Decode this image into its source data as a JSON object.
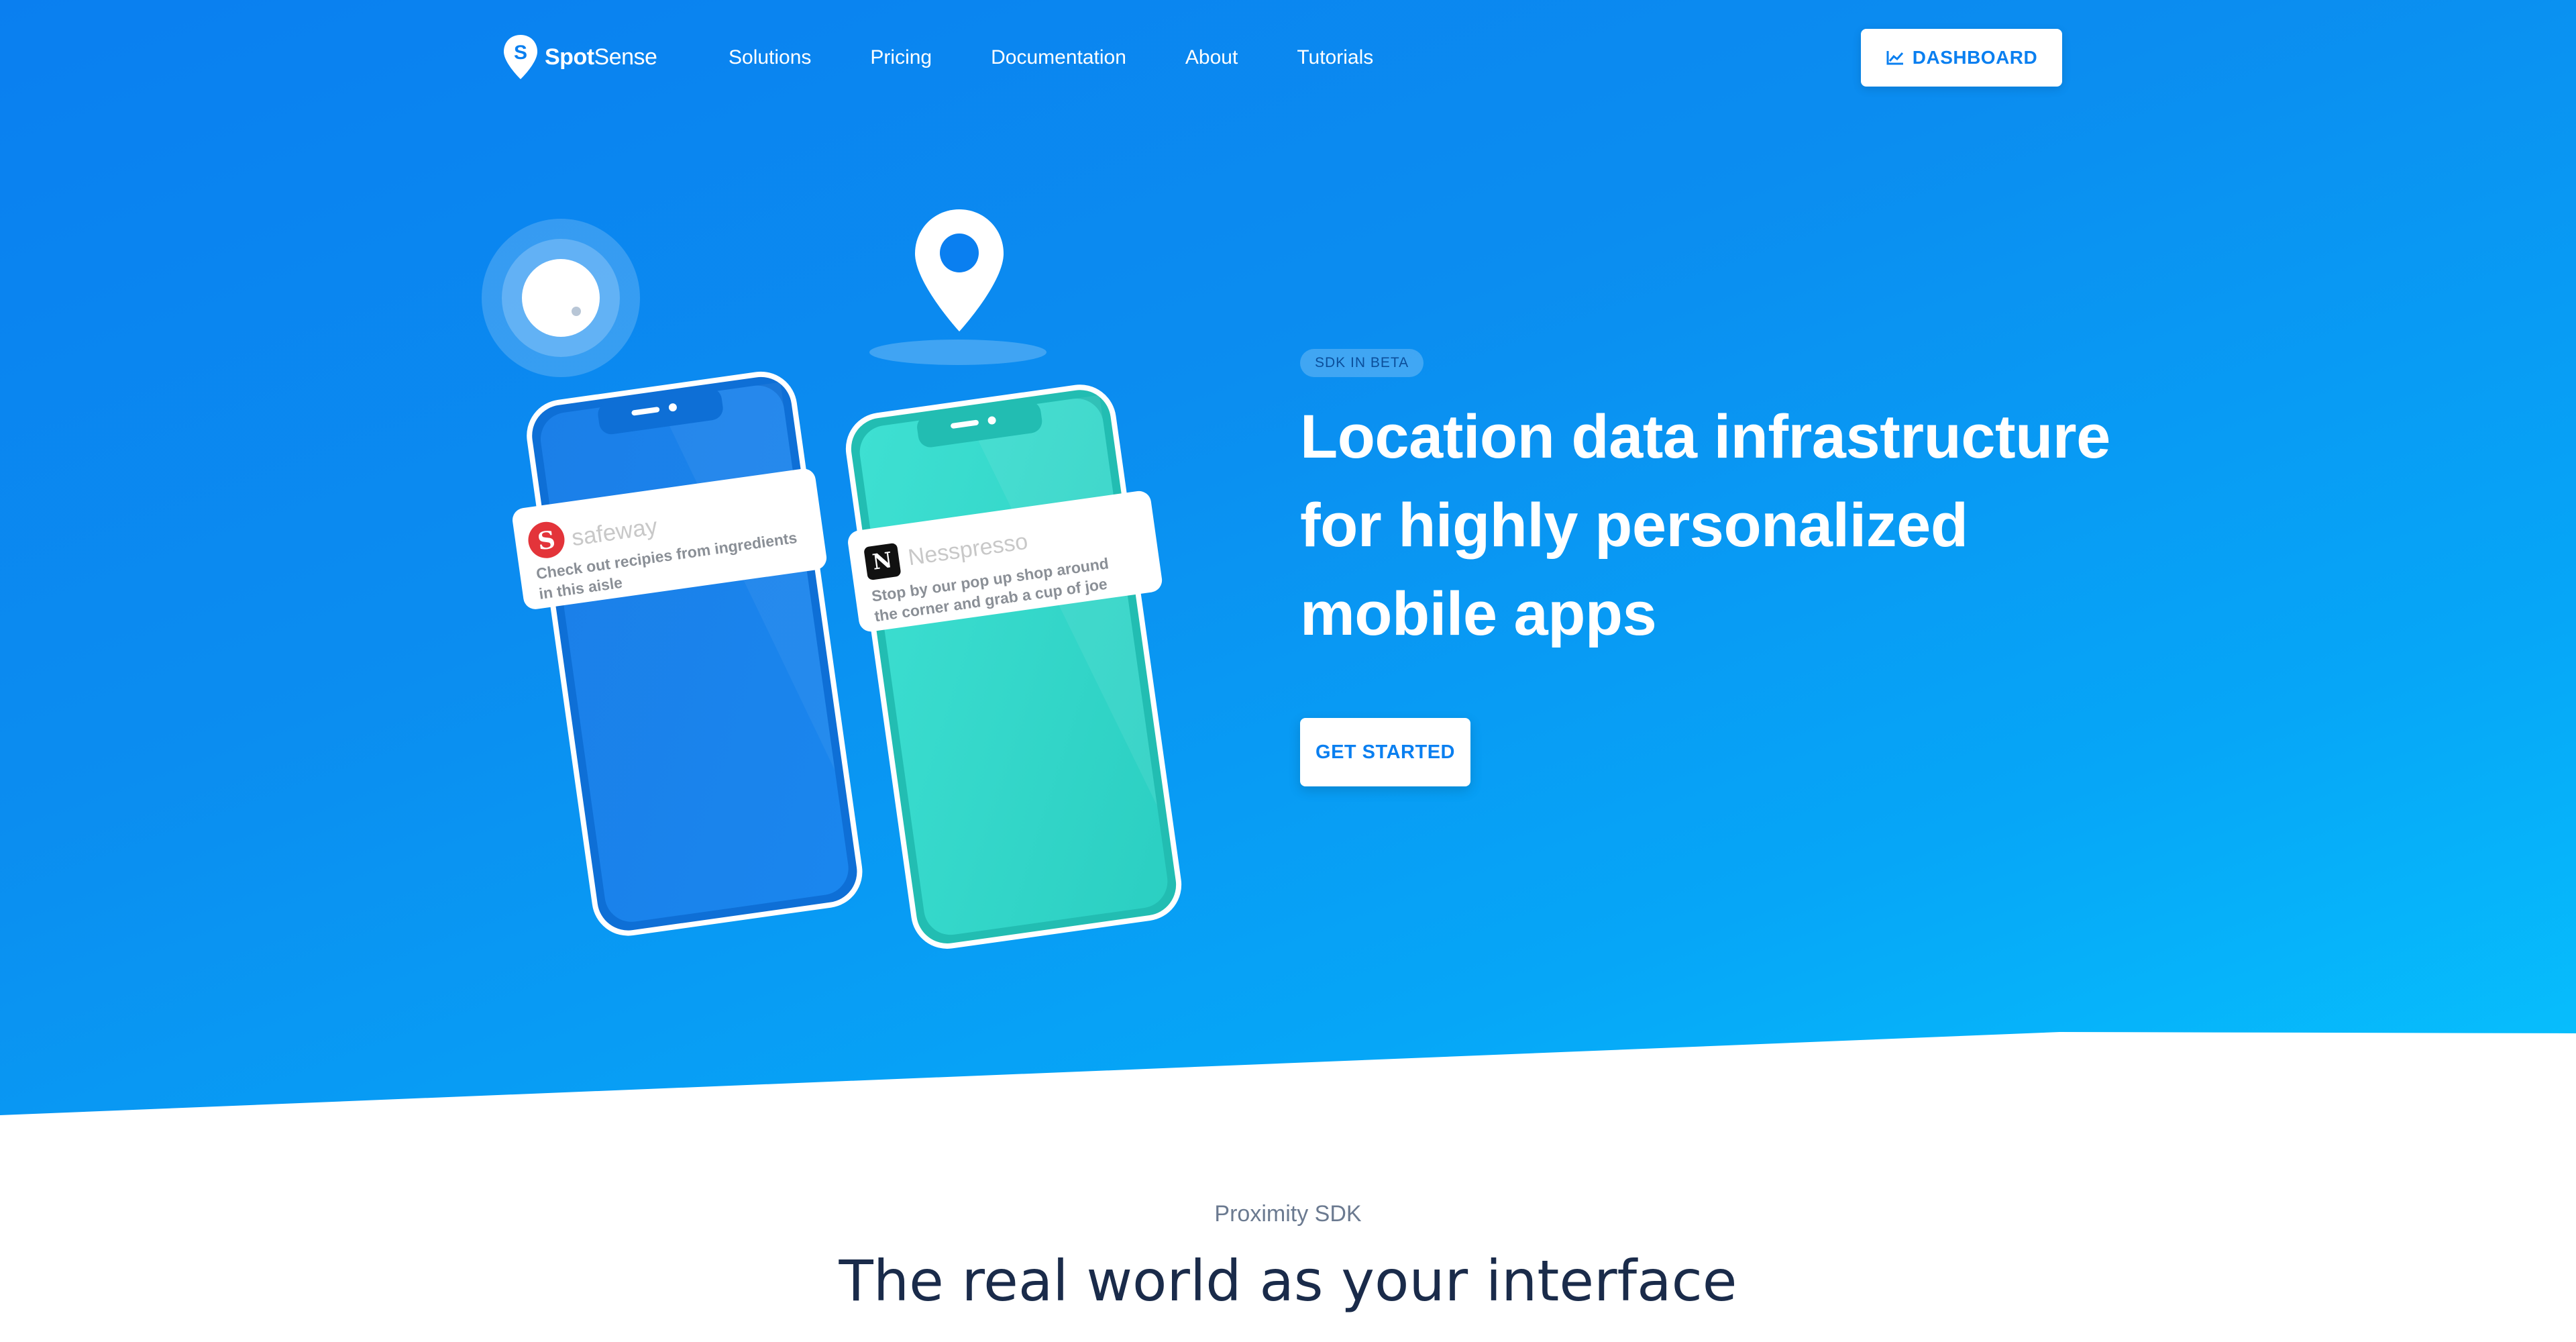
{
  "brand": {
    "name_bold": "Spot",
    "name_light": "Sense"
  },
  "nav": {
    "links": [
      "Solutions",
      "Pricing",
      "Documentation",
      "About",
      "Tutorials"
    ],
    "dashboard_label": "DASHBOARD"
  },
  "hero": {
    "badge": "SDK IN BETA",
    "headline": "Location data infrastructure for highly personalized mobile apps",
    "cta_label": "GET STARTED"
  },
  "notifications": [
    {
      "brand": "safeway",
      "message": "Check out recipies from ingredients in this aisle",
      "color": "#e3343a"
    },
    {
      "brand": "Nesspresso",
      "message": "Stop by our pop up shop around the corner and grab a cup of joe",
      "color": "#111111"
    }
  ],
  "section": {
    "eyebrow": "Proximity SDK",
    "title": "The real world as your interface"
  },
  "colors": {
    "primary": "#0a7ff0",
    "hero_end": "#07c2fd",
    "phone_blue": "#1b86ee",
    "phone_teal": "#35d6cc"
  }
}
